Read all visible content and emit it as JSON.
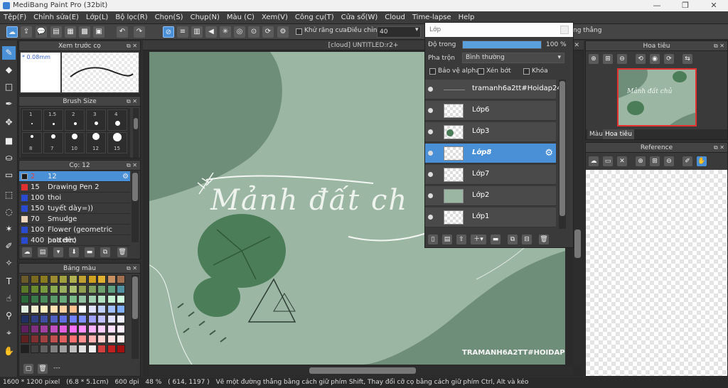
{
  "app": {
    "title": "MediBang Paint Pro (32bit)",
    "min": "—",
    "max": "❐",
    "close": "✕"
  },
  "menu": [
    "Tệp(F)",
    "Chỉnh sửa(E)",
    "Lớp(L)",
    "Bộ lọc(R)",
    "Chọn(S)",
    "Chụp(N)",
    "Màu (C)",
    "Xem(V)",
    "Công cụ(T)",
    "Cửa sổ(W)",
    "Cloud",
    "Time-lapse",
    "Help"
  ],
  "toolbar": {
    "antialias_label": "Khử răng cưa",
    "adjust_label": "Điều chỉnh",
    "adjust_value": "40",
    "straight_label": "ng thẳng"
  },
  "brush_preview": {
    "title": "Xem trước cọ",
    "size_label": "* 0.08mm"
  },
  "brush_size": {
    "title": "Brush Size",
    "sizes": [
      "1",
      "1.5",
      "2",
      "3",
      "4",
      "5",
      "8",
      "7",
      "10",
      "12",
      "15"
    ]
  },
  "brush_list": {
    "title": "Cọ: 12",
    "items": [
      {
        "num": "2",
        "name": "12",
        "color": "#1a1a1a",
        "selected": true
      },
      {
        "num": "15",
        "name": "Drawing Pen 2",
        "color": "#e03030",
        "selected": false
      },
      {
        "num": "100",
        "name": "thoi",
        "color": "#2a4ad0",
        "selected": false
      },
      {
        "num": "150",
        "name": "tuyết dày=))",
        "color": "#2a4ad0",
        "selected": false
      },
      {
        "num": "70",
        "name": "Smudge",
        "color": "#f0d8c0",
        "selected": false
      },
      {
        "num": "100",
        "name": "Flower (geometric pattern)",
        "color": "#2a4ad0",
        "selected": false
      },
      {
        "num": "400",
        "name": "hoa đèo",
        "color": "#2a4ad0",
        "selected": false
      }
    ]
  },
  "palette": {
    "title": "Bảng màu",
    "extra": "---"
  },
  "canvas": {
    "tab": "[cloud] UNTITLED:r2+",
    "text": "Mảnh đất ch",
    "watermark": "TRAMANH6A2TT#HOIDAP247"
  },
  "layers": {
    "title": "Lớp",
    "opacity_label": "Độ trong",
    "opacity_value": "100 %",
    "blend_label": "Pha trộn",
    "blend_value": "Bình thường",
    "protect_alpha": "Bảo vệ alpha",
    "clip": "Xén bớt",
    "lock": "Khóa",
    "items": [
      {
        "name": "tramanh6a2tt#Hoidap247",
        "selected": false
      },
      {
        "name": "Lớp6",
        "selected": false
      },
      {
        "name": "Lớp3",
        "selected": false
      },
      {
        "name": "Lớp8",
        "selected": true
      },
      {
        "name": "Lớp7",
        "selected": false
      },
      {
        "name": "Lớp2",
        "selected": false
      },
      {
        "name": "Lớp1",
        "selected": false
      }
    ]
  },
  "navigator": {
    "title": "Hoa tiêu",
    "tab1": "Màu",
    "tab2": "Hoa tiêu",
    "thumb_text": "Mảnh đất chủ"
  },
  "reference": {
    "title": "Reference"
  },
  "status": {
    "size": "1600 * 1200 pixel",
    "cm": "(6.8 * 5.1cm)",
    "dpi": "600 dpi",
    "zoom": "48 %",
    "coords": "( 614, 1197 )",
    "hint": "Vẽ một đường thẳng bằng cách giữ phím Shift, Thay đổi cỡ cọ bằng cách giữ phím Ctrl, Alt và kéo"
  }
}
